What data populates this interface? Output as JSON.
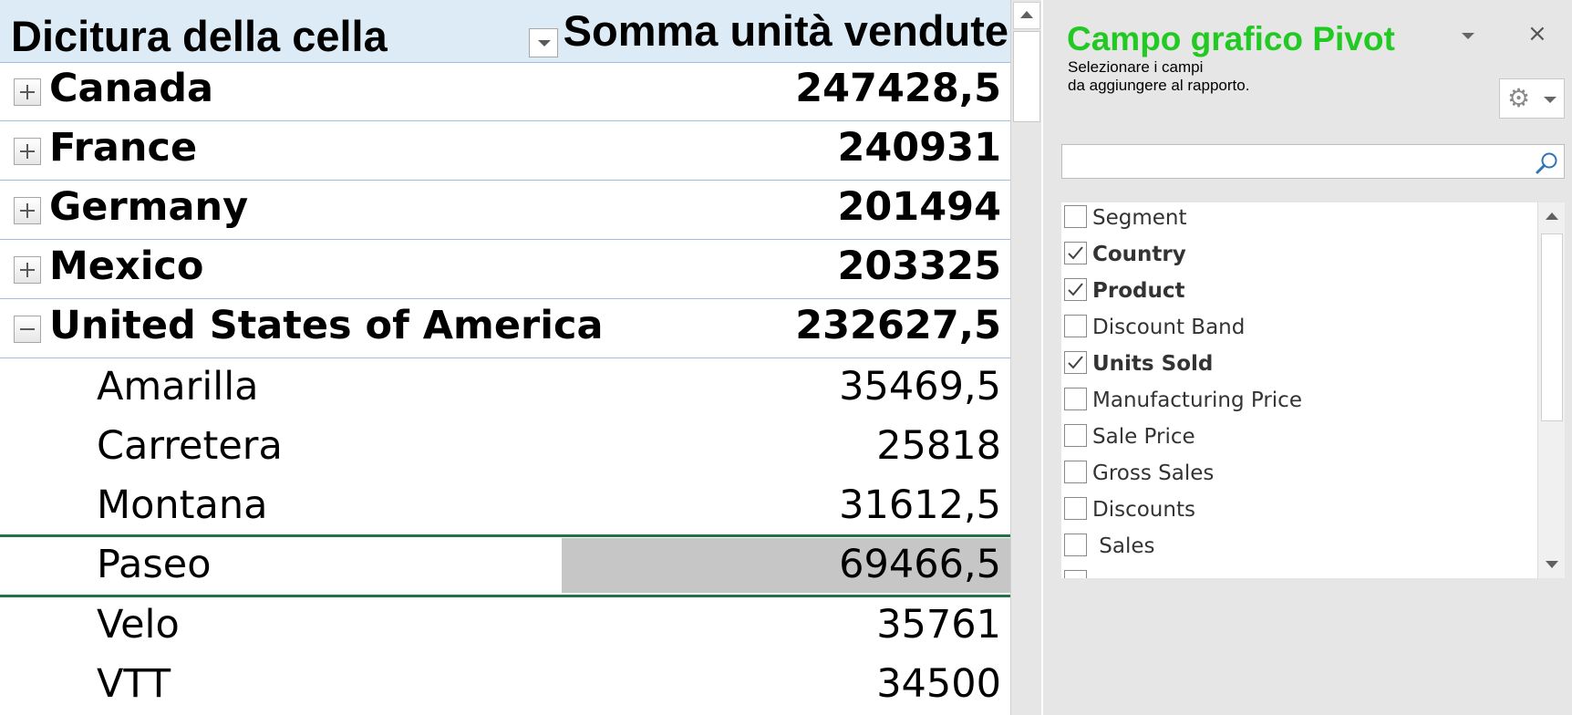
{
  "pivot": {
    "header_label": "Dicitura della cella",
    "header_sum": "Somma unità vendute",
    "countries": [
      {
        "label": "Canada",
        "value": "247428,5",
        "expanded": false
      },
      {
        "label": "France",
        "value": "240931",
        "expanded": false
      },
      {
        "label": "Germany",
        "value": "201494",
        "expanded": false
      },
      {
        "label": "Mexico",
        "value": "203325",
        "expanded": false
      },
      {
        "label": "United States of America",
        "value": "232627,5",
        "expanded": true
      }
    ],
    "products": [
      {
        "label": "Amarilla",
        "value": "35469,5"
      },
      {
        "label": "Carretera",
        "value": "25818"
      },
      {
        "label": "Montana",
        "value": "31612,5"
      },
      {
        "label": "Paseo",
        "value": "69466,5",
        "selected": true
      },
      {
        "label": "Velo",
        "value": "35761"
      },
      {
        "label": "VTT",
        "value": "34500"
      }
    ]
  },
  "field_pane": {
    "title": "Campo grafico Pivot",
    "subtitle_line1": "Selezionare i campi",
    "subtitle_line2": "da aggiungere al rapporto.",
    "close_glyph": "×",
    "gear_glyph": "⚙",
    "search": {
      "value": "",
      "placeholder": ""
    },
    "fields": [
      {
        "label": "Segment",
        "checked": false
      },
      {
        "label": "Country",
        "checked": true
      },
      {
        "label": "Product",
        "checked": true
      },
      {
        "label": "Discount Band",
        "checked": false
      },
      {
        "label": "Units Sold",
        "checked": true
      },
      {
        "label": "Manufacturing Price",
        "checked": false
      },
      {
        "label": "Sale Price",
        "checked": false
      },
      {
        "label": "Gross Sales",
        "checked": false
      },
      {
        "label": "Discounts",
        "checked": false
      },
      {
        "label": " Sales",
        "checked": false
      }
    ],
    "title_color": "#22c922"
  },
  "colors": {
    "header_bg": "#ddebf7",
    "row_border": "#9bc2e6",
    "selection_border": "#217346",
    "selected_cell_bg": "#c6c6c6"
  }
}
